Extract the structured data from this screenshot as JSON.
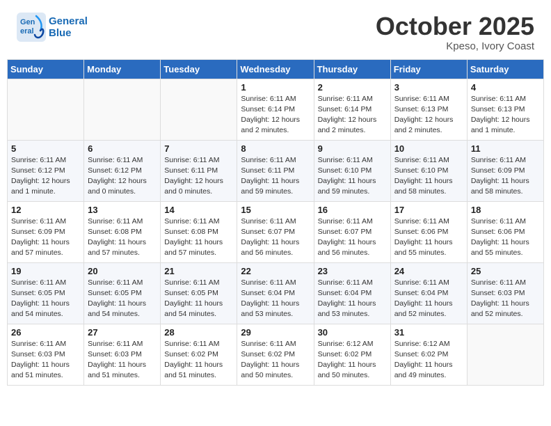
{
  "header": {
    "logo_line1": "General",
    "logo_line2": "Blue",
    "month": "October 2025",
    "location": "Kpeso, Ivory Coast"
  },
  "weekdays": [
    "Sunday",
    "Monday",
    "Tuesday",
    "Wednesday",
    "Thursday",
    "Friday",
    "Saturday"
  ],
  "weeks": [
    [
      {
        "day": "",
        "content": ""
      },
      {
        "day": "",
        "content": ""
      },
      {
        "day": "",
        "content": ""
      },
      {
        "day": "1",
        "content": "Sunrise: 6:11 AM\nSunset: 6:14 PM\nDaylight: 12 hours and 2 minutes."
      },
      {
        "day": "2",
        "content": "Sunrise: 6:11 AM\nSunset: 6:14 PM\nDaylight: 12 hours and 2 minutes."
      },
      {
        "day": "3",
        "content": "Sunrise: 6:11 AM\nSunset: 6:13 PM\nDaylight: 12 hours and 2 minutes."
      },
      {
        "day": "4",
        "content": "Sunrise: 6:11 AM\nSunset: 6:13 PM\nDaylight: 12 hours and 1 minute."
      }
    ],
    [
      {
        "day": "5",
        "content": "Sunrise: 6:11 AM\nSunset: 6:12 PM\nDaylight: 12 hours and 1 minute."
      },
      {
        "day": "6",
        "content": "Sunrise: 6:11 AM\nSunset: 6:12 PM\nDaylight: 12 hours and 0 minutes."
      },
      {
        "day": "7",
        "content": "Sunrise: 6:11 AM\nSunset: 6:11 PM\nDaylight: 12 hours and 0 minutes."
      },
      {
        "day": "8",
        "content": "Sunrise: 6:11 AM\nSunset: 6:11 PM\nDaylight: 11 hours and 59 minutes."
      },
      {
        "day": "9",
        "content": "Sunrise: 6:11 AM\nSunset: 6:10 PM\nDaylight: 11 hours and 59 minutes."
      },
      {
        "day": "10",
        "content": "Sunrise: 6:11 AM\nSunset: 6:10 PM\nDaylight: 11 hours and 58 minutes."
      },
      {
        "day": "11",
        "content": "Sunrise: 6:11 AM\nSunset: 6:09 PM\nDaylight: 11 hours and 58 minutes."
      }
    ],
    [
      {
        "day": "12",
        "content": "Sunrise: 6:11 AM\nSunset: 6:09 PM\nDaylight: 11 hours and 57 minutes."
      },
      {
        "day": "13",
        "content": "Sunrise: 6:11 AM\nSunset: 6:08 PM\nDaylight: 11 hours and 57 minutes."
      },
      {
        "day": "14",
        "content": "Sunrise: 6:11 AM\nSunset: 6:08 PM\nDaylight: 11 hours and 57 minutes."
      },
      {
        "day": "15",
        "content": "Sunrise: 6:11 AM\nSunset: 6:07 PM\nDaylight: 11 hours and 56 minutes."
      },
      {
        "day": "16",
        "content": "Sunrise: 6:11 AM\nSunset: 6:07 PM\nDaylight: 11 hours and 56 minutes."
      },
      {
        "day": "17",
        "content": "Sunrise: 6:11 AM\nSunset: 6:06 PM\nDaylight: 11 hours and 55 minutes."
      },
      {
        "day": "18",
        "content": "Sunrise: 6:11 AM\nSunset: 6:06 PM\nDaylight: 11 hours and 55 minutes."
      }
    ],
    [
      {
        "day": "19",
        "content": "Sunrise: 6:11 AM\nSunset: 6:05 PM\nDaylight: 11 hours and 54 minutes."
      },
      {
        "day": "20",
        "content": "Sunrise: 6:11 AM\nSunset: 6:05 PM\nDaylight: 11 hours and 54 minutes."
      },
      {
        "day": "21",
        "content": "Sunrise: 6:11 AM\nSunset: 6:05 PM\nDaylight: 11 hours and 54 minutes."
      },
      {
        "day": "22",
        "content": "Sunrise: 6:11 AM\nSunset: 6:04 PM\nDaylight: 11 hours and 53 minutes."
      },
      {
        "day": "23",
        "content": "Sunrise: 6:11 AM\nSunset: 6:04 PM\nDaylight: 11 hours and 53 minutes."
      },
      {
        "day": "24",
        "content": "Sunrise: 6:11 AM\nSunset: 6:04 PM\nDaylight: 11 hours and 52 minutes."
      },
      {
        "day": "25",
        "content": "Sunrise: 6:11 AM\nSunset: 6:03 PM\nDaylight: 11 hours and 52 minutes."
      }
    ],
    [
      {
        "day": "26",
        "content": "Sunrise: 6:11 AM\nSunset: 6:03 PM\nDaylight: 11 hours and 51 minutes."
      },
      {
        "day": "27",
        "content": "Sunrise: 6:11 AM\nSunset: 6:03 PM\nDaylight: 11 hours and 51 minutes."
      },
      {
        "day": "28",
        "content": "Sunrise: 6:11 AM\nSunset: 6:02 PM\nDaylight: 11 hours and 51 minutes."
      },
      {
        "day": "29",
        "content": "Sunrise: 6:11 AM\nSunset: 6:02 PM\nDaylight: 11 hours and 50 minutes."
      },
      {
        "day": "30",
        "content": "Sunrise: 6:12 AM\nSunset: 6:02 PM\nDaylight: 11 hours and 50 minutes."
      },
      {
        "day": "31",
        "content": "Sunrise: 6:12 AM\nSunset: 6:02 PM\nDaylight: 11 hours and 49 minutes."
      },
      {
        "day": "",
        "content": ""
      }
    ]
  ]
}
